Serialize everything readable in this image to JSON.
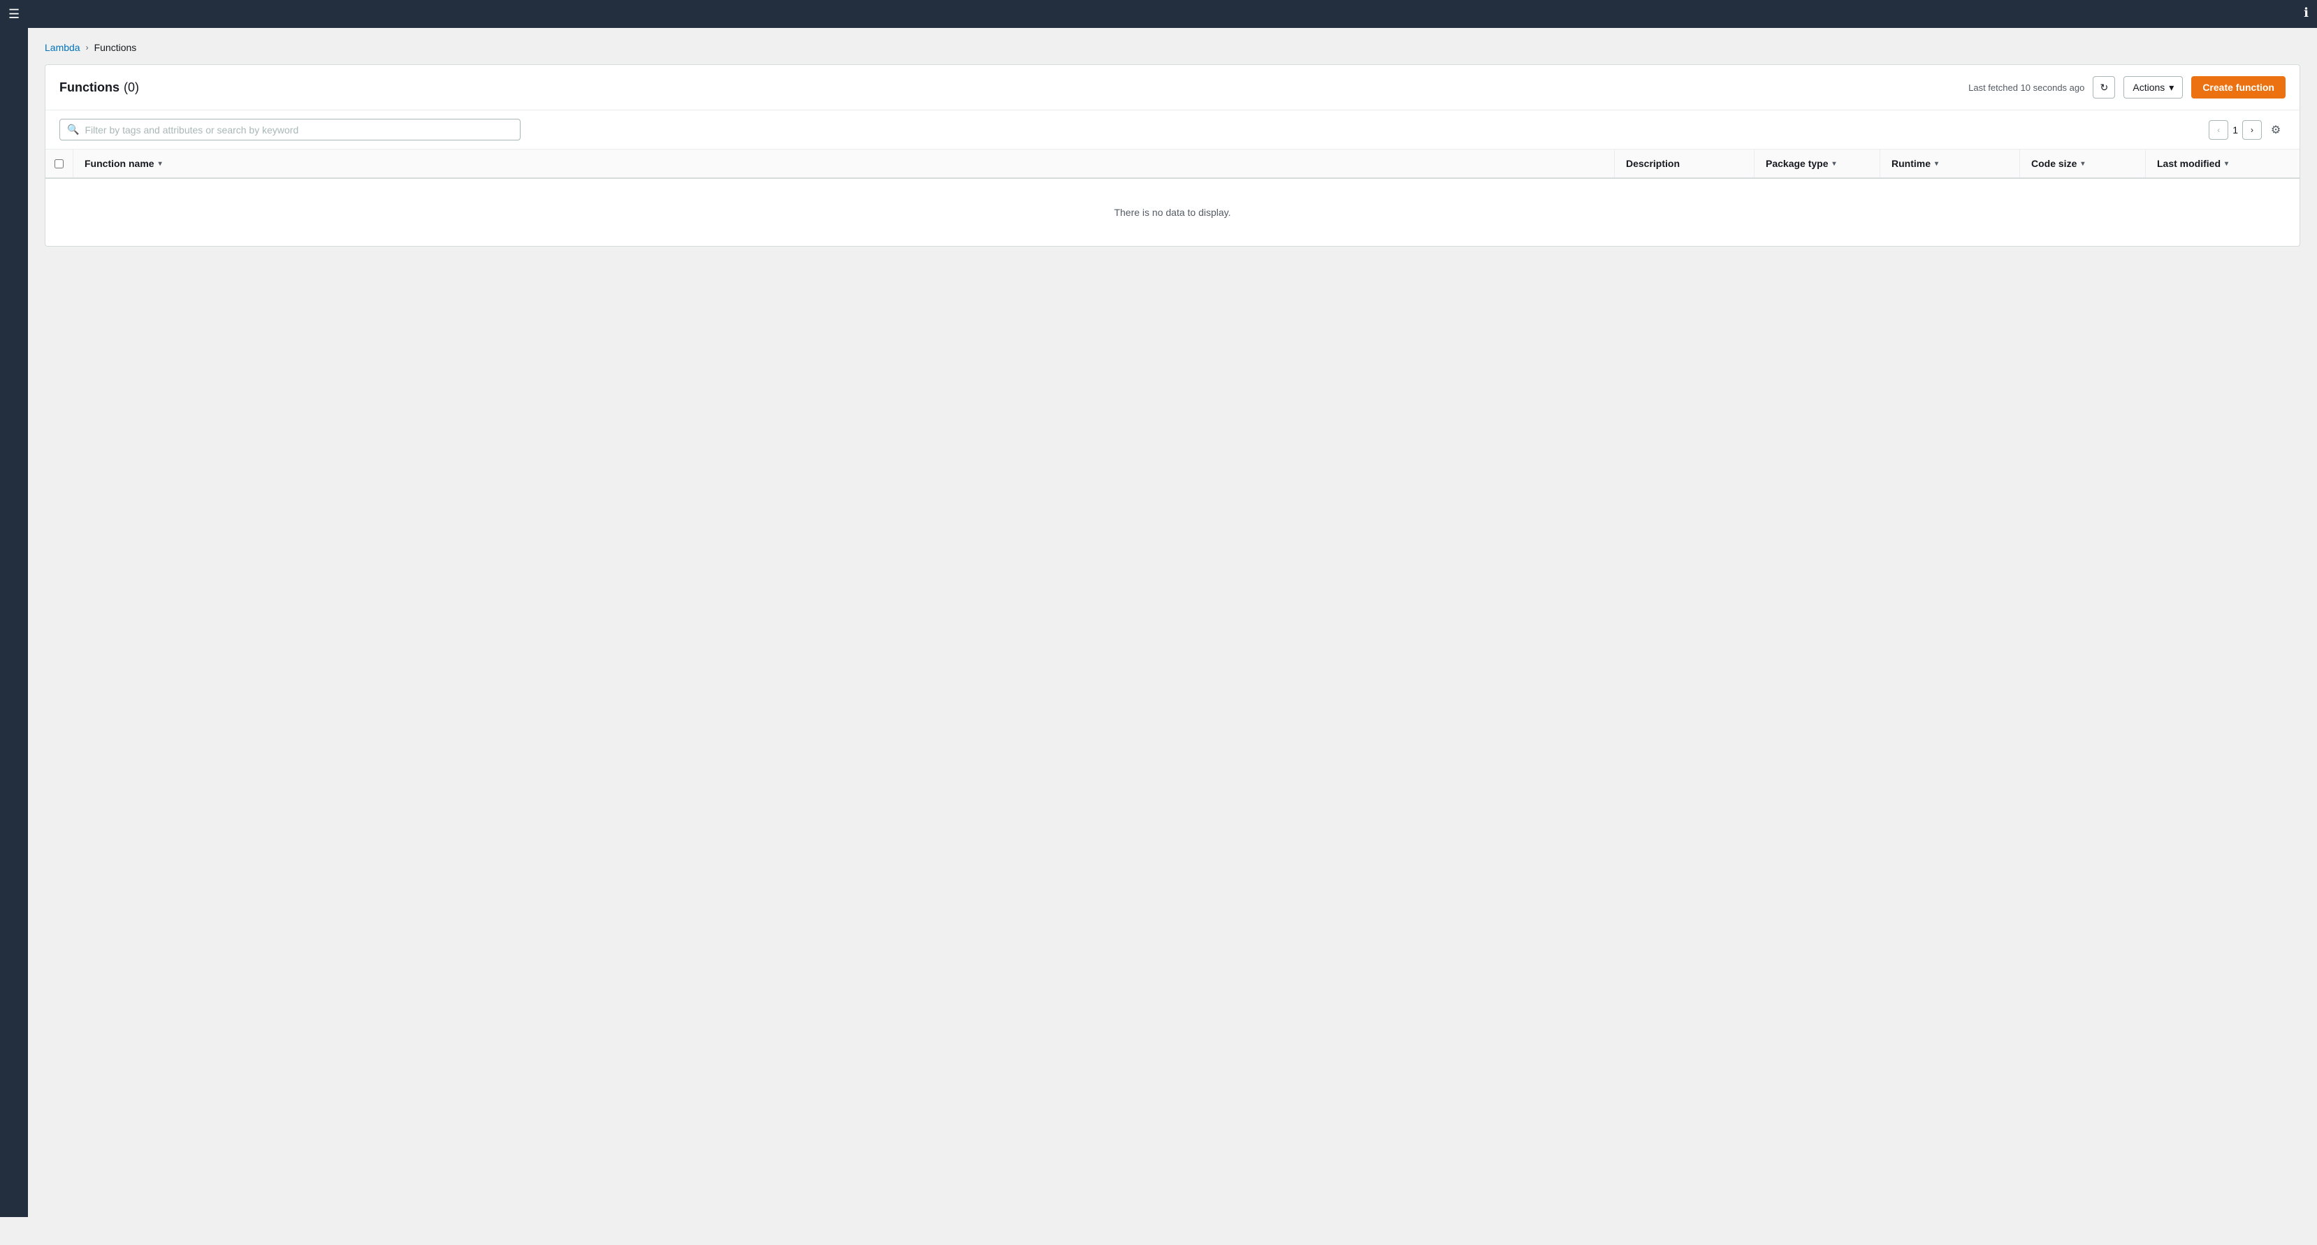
{
  "topnav": {
    "hamburger": "☰"
  },
  "info_icon": "ℹ",
  "breadcrumb": {
    "lambda_label": "Lambda",
    "separator": "›",
    "current": "Functions"
  },
  "panel": {
    "title": "Functions",
    "count": "(0)",
    "last_fetched_label": "Last fetched 10 seconds ago",
    "refresh_icon": "↻",
    "actions_label": "Actions",
    "actions_chevron": "▾",
    "create_button_label": "Create function",
    "search_placeholder": "Filter by tags and attributes or search by keyword",
    "pagination_prev_icon": "‹",
    "pagination_next_icon": "›",
    "pagination_current": "1",
    "settings_icon": "⚙",
    "table": {
      "columns": [
        {
          "label": "Function name",
          "sortable": true
        },
        {
          "label": "Description",
          "sortable": false
        },
        {
          "label": "Package type",
          "sortable": true
        },
        {
          "label": "Runtime",
          "sortable": true
        },
        {
          "label": "Code size",
          "sortable": true
        },
        {
          "label": "Last modified",
          "sortable": true
        }
      ],
      "empty_message": "There is no data to display."
    }
  }
}
